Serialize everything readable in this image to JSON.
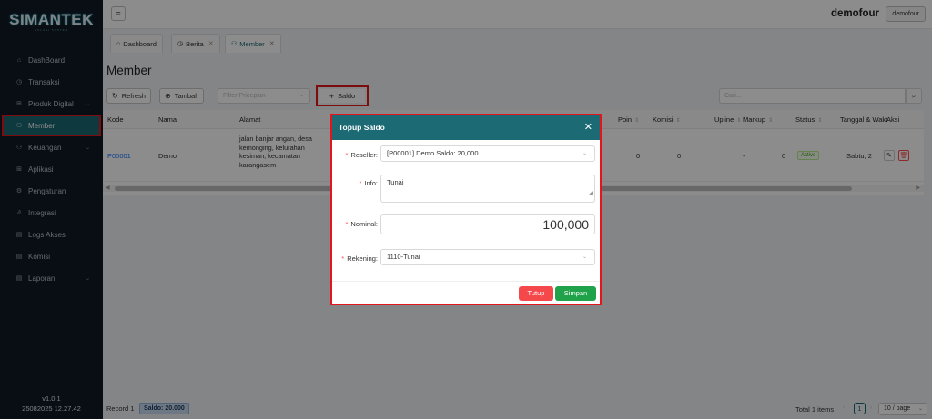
{
  "app": {
    "logo": "SIMANTEK",
    "logo_sub": "SOLUSI SYSTEM"
  },
  "sidebar": {
    "items": [
      {
        "label": "DashBoard",
        "icon": "home-icon"
      },
      {
        "label": "Transaksi",
        "icon": "clock-icon"
      },
      {
        "label": "Produk Digital",
        "icon": "grid-icon"
      },
      {
        "label": "Member",
        "icon": "users-icon"
      },
      {
        "label": "Keuangan",
        "icon": "users-icon"
      },
      {
        "label": "Aplikasi",
        "icon": "grid-icon"
      },
      {
        "label": "Pengaturan",
        "icon": "gear-icon"
      },
      {
        "label": "Integrasi",
        "icon": "link-icon"
      },
      {
        "label": "Logs Akses",
        "icon": "file-icon"
      },
      {
        "label": "Komisi",
        "icon": "file-icon"
      },
      {
        "label": "Laporan",
        "icon": "file-icon"
      }
    ],
    "version": "v1.0.1",
    "build": "25082025 12.27.42"
  },
  "topbar": {
    "user": "demofour",
    "user_button": "demofour"
  },
  "tabs": [
    {
      "label": "Dashboard"
    },
    {
      "label": "Berita"
    },
    {
      "label": "Member"
    }
  ],
  "page": {
    "title": "Member"
  },
  "toolbar": {
    "refresh": "Refresh",
    "tambah": "Tambah",
    "filter_placeholder": "Filter Priceplan",
    "saldo": "Saldo",
    "search_placeholder": "Cari..."
  },
  "table": {
    "columns": [
      "Kode",
      "Nama",
      "Alamat",
      "Poin",
      "Komisi",
      "Upline",
      "Markup",
      "Status",
      "Tanggal & Waktu Daftar",
      "Aksi"
    ],
    "rows": [
      {
        "kode": "P00001",
        "nama": "Demo",
        "alamat": "jalan banjar angan, desa kemonging, kelurahan kesiman, kecamatan karangasem",
        "poin": "0",
        "komisi": "0",
        "upline": "-",
        "markup": "0",
        "status": "Active",
        "tanggal": "Sabtu, 2"
      }
    ]
  },
  "footer": {
    "record": "Record 1",
    "saldo": "Saldo: 20.000",
    "total": "Total 1 items",
    "page": "1",
    "per_page": "10 / page"
  },
  "modal": {
    "title": "Topup Saldo",
    "reseller_label": "Reseller:",
    "reseller_value": "[P00001] Demo Saldo: 20,000",
    "info_label": "Info:",
    "info_value": "Tunai",
    "nominal_label": "Nominal:",
    "nominal_value": "100,000",
    "rekening_label": "Rekening:",
    "rekening_value": "1110-Tunai",
    "tutup": "Tutup",
    "simpan": "Simpan"
  },
  "colors": {
    "sidebar_bg": "#0f1b26",
    "accent": "#1b6a74",
    "highlight_border": "#e4161b",
    "danger": "#f5484b",
    "success": "#20a24a"
  }
}
